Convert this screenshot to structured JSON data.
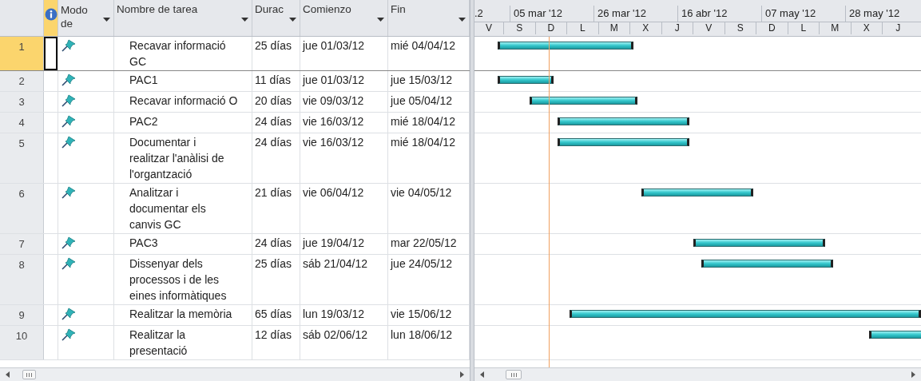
{
  "table": {
    "columns": [
      {
        "kind": "mode",
        "label": "Modo de"
      },
      {
        "kind": "name",
        "label": "Nombre de tarea"
      },
      {
        "kind": "duration",
        "label": "Durac"
      },
      {
        "kind": "start",
        "label": "Comienzo"
      },
      {
        "kind": "end",
        "label": "Fin"
      }
    ],
    "rows": [
      {
        "id": "1",
        "name": "Recavar informació\nGC",
        "duration": "25 días",
        "start": "jue 01/03/12",
        "end": "mié 04/04/12",
        "selected": true
      },
      {
        "id": "2",
        "name": "PAC1",
        "duration": "11 días",
        "start": "jue 01/03/12",
        "end": "jue 15/03/12",
        "selected": false
      },
      {
        "id": "3",
        "name": "Recavar informació O",
        "duration": "20 días",
        "start": "vie 09/03/12",
        "end": "jue 05/04/12",
        "selected": false
      },
      {
        "id": "4",
        "name": "PAC2",
        "duration": "24 días",
        "start": "vie 16/03/12",
        "end": "mié 18/04/12",
        "selected": false
      },
      {
        "id": "5",
        "name": "Documentar i\nrealitzar l'anàlisi de\nl'organtzació",
        "duration": "24 días",
        "start": "vie 16/03/12",
        "end": "mié 18/04/12",
        "selected": false
      },
      {
        "id": "6",
        "name": "Analitzar i\ndocumentar els\ncanvis GC",
        "duration": "21 días",
        "start": "vie 06/04/12",
        "end": "vie 04/05/12",
        "selected": false
      },
      {
        "id": "7",
        "name": "PAC3",
        "duration": "24 días",
        "start": "jue 19/04/12",
        "end": "mar 22/05/12",
        "selected": false
      },
      {
        "id": "8",
        "name": "Dissenyar dels\nprocessos i de les\neines informàtiques",
        "duration": "25 días",
        "start": "sáb 21/04/12",
        "end": "jue 24/05/12",
        "selected": false
      },
      {
        "id": "9",
        "name": "Realitzar la memòria",
        "duration": "65 días",
        "start": "lun 19/03/12",
        "end": "vie 15/06/12",
        "selected": false
      },
      {
        "id": "10",
        "name": "Realitzar la\npresentació",
        "duration": "12 días",
        "start": "sáb 02/06/12",
        "end": "lun 18/06/12",
        "selected": false
      }
    ]
  },
  "timeline": {
    "top_tier": [
      ".2",
      "05 mar '12",
      "26 mar '12",
      "16 abr '12",
      "07 may '12",
      "28 may '12"
    ],
    "bottom_tier": [
      "V",
      "S",
      "D",
      "L",
      "M",
      "X",
      "J",
      "V",
      "S",
      "D",
      "L",
      "M",
      "X",
      "J"
    ]
  }
}
